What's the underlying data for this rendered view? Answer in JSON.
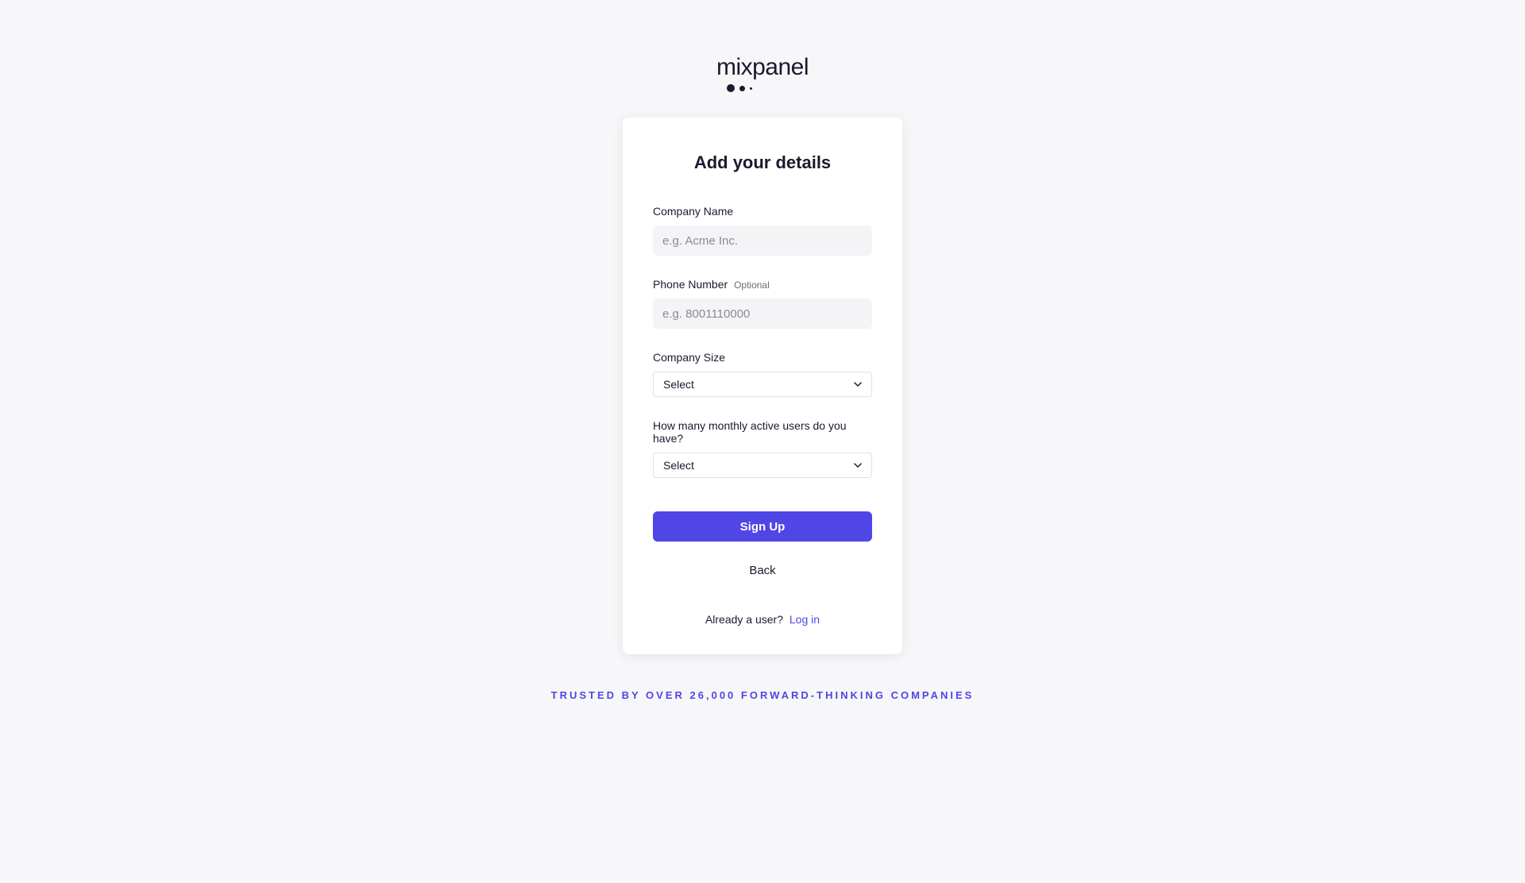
{
  "logo": {
    "text": "mixpanel"
  },
  "card": {
    "title": "Add your details"
  },
  "form": {
    "companyName": {
      "label": "Company Name",
      "placeholder": "e.g. Acme Inc."
    },
    "phoneNumber": {
      "label": "Phone Number",
      "optionalText": "Optional",
      "placeholder": "e.g. 8001110000"
    },
    "companySize": {
      "label": "Company Size",
      "selected": "Select"
    },
    "monthlyActiveUsers": {
      "label": "How many monthly active users do you have?",
      "selected": "Select"
    }
  },
  "buttons": {
    "signUp": "Sign Up",
    "back": "Back"
  },
  "loginPrompt": {
    "text": "Already a user?",
    "linkText": "Log in"
  },
  "footer": {
    "trustedText": "TRUSTED BY OVER 26,000 FORWARD-THINKING COMPANIES"
  }
}
